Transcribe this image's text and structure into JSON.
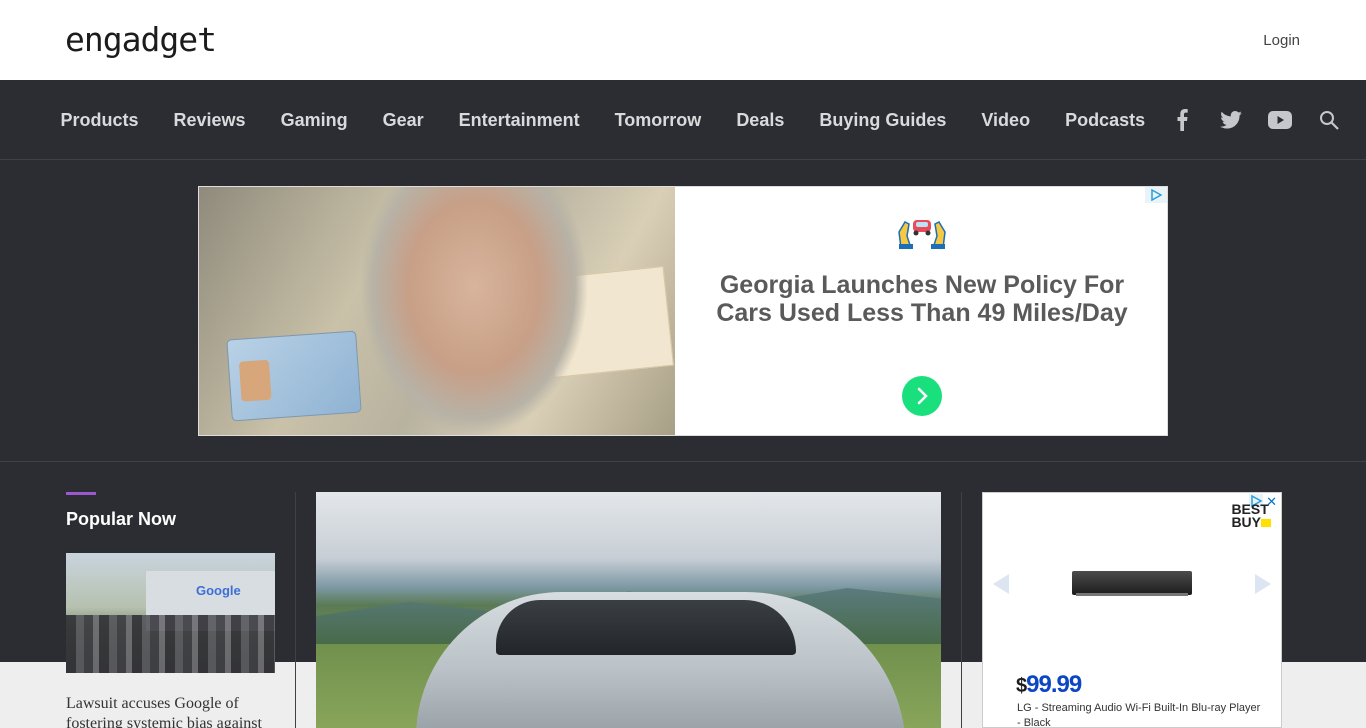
{
  "header": {
    "logo_text": "engadget",
    "login_label": "Login"
  },
  "nav": {
    "items": [
      {
        "label": "Products"
      },
      {
        "label": "Reviews"
      },
      {
        "label": "Gaming"
      },
      {
        "label": "Gear"
      },
      {
        "label": "Entertainment"
      },
      {
        "label": "Tomorrow"
      },
      {
        "label": "Deals"
      },
      {
        "label": "Buying Guides"
      },
      {
        "label": "Video"
      },
      {
        "label": "Podcasts"
      }
    ],
    "icons": [
      "facebook-icon",
      "twitter-icon",
      "youtube-icon",
      "search-icon"
    ]
  },
  "banner_ad": {
    "headline_line1": "Georgia Launches New Policy For",
    "headline_line2": "Cars Used Less Than 49 Miles/Day",
    "arrow_color": "#19e07c"
  },
  "popular": {
    "title": "Popular Now",
    "accent_color": "#9b59d0",
    "thumb_logo_text": "Google",
    "article_text": "Lawsuit accuses Google of fostering systemic bias against"
  },
  "side_ad": {
    "brand_line1": "BEST",
    "brand_line2": "BUY",
    "close_label": "✕",
    "price_currency": "$",
    "price_value": "99.99",
    "description": "LG - Streaming Audio Wi-Fi Built-In Blu-ray Player - Black"
  },
  "colors": {
    "nav_bg": "#2b2d32",
    "price_blue": "#0c46c4"
  }
}
